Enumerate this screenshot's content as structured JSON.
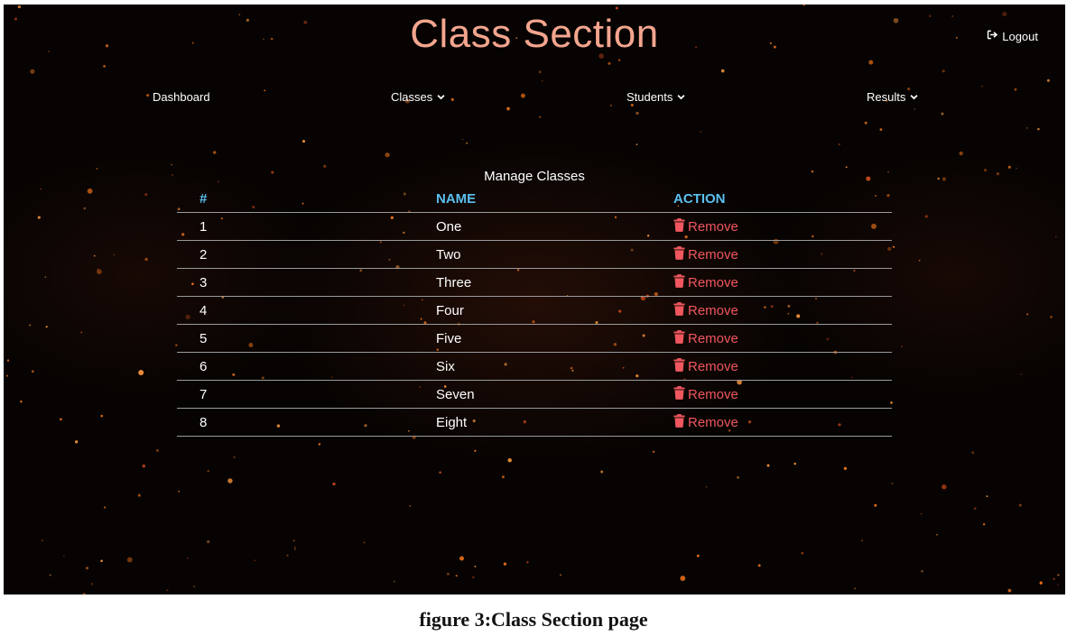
{
  "app": {
    "title": "Class Section",
    "logout_label": "Logout"
  },
  "nav": {
    "items": [
      {
        "label": "Dashboard",
        "has_dropdown": false
      },
      {
        "label": "Classes",
        "has_dropdown": true
      },
      {
        "label": "Students",
        "has_dropdown": true
      },
      {
        "label": "Results",
        "has_dropdown": true
      }
    ]
  },
  "table": {
    "caption": "Manage Classes",
    "headers": {
      "num": "#",
      "name": "NAME",
      "action": "ACTION"
    },
    "rows": [
      {
        "num": "1",
        "name": "One",
        "action": "Remove"
      },
      {
        "num": "2",
        "name": "Two",
        "action": "Remove"
      },
      {
        "num": "3",
        "name": "Three",
        "action": "Remove"
      },
      {
        "num": "4",
        "name": "Four",
        "action": "Remove"
      },
      {
        "num": "5",
        "name": "Five",
        "action": "Remove"
      },
      {
        "num": "6",
        "name": "Six",
        "action": "Remove"
      },
      {
        "num": "7",
        "name": "Seven",
        "action": "Remove"
      },
      {
        "num": "8",
        "name": "Eight",
        "action": "Remove"
      }
    ]
  },
  "figure_caption": "figure 3:Class Section page",
  "colors": {
    "title": "#f4a58e",
    "header_accent": "#5bc0f0",
    "remove": "#f0575e",
    "background": "#060302"
  },
  "icons": {
    "logout": "logout-icon",
    "dropdown": "chevron-down-icon",
    "remove": "trash-icon"
  }
}
